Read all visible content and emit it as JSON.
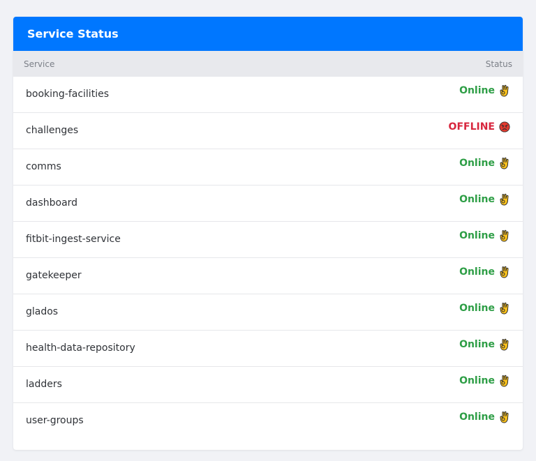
{
  "card": {
    "title": "Service Status",
    "columns": {
      "service": "Service",
      "status": "Status"
    }
  },
  "services": [
    {
      "name": "booking-facilities",
      "status": "Online",
      "state": "online",
      "icon": "ok-hand-icon"
    },
    {
      "name": "challenges",
      "status": "OFFLINE",
      "state": "offline",
      "icon": "angry-face-icon"
    },
    {
      "name": "comms",
      "status": "Online",
      "state": "online",
      "icon": "ok-hand-icon"
    },
    {
      "name": "dashboard",
      "status": "Online",
      "state": "online",
      "icon": "ok-hand-icon"
    },
    {
      "name": "fitbit-ingest-service",
      "status": "Online",
      "state": "online",
      "icon": "ok-hand-icon"
    },
    {
      "name": "gatekeeper",
      "status": "Online",
      "state": "online",
      "icon": "ok-hand-icon"
    },
    {
      "name": "glados",
      "status": "Online",
      "state": "online",
      "icon": "ok-hand-icon"
    },
    {
      "name": "health-data-repository",
      "status": "Online",
      "state": "online",
      "icon": "ok-hand-icon"
    },
    {
      "name": "ladders",
      "status": "Online",
      "state": "online",
      "icon": "ok-hand-icon"
    },
    {
      "name": "user-groups",
      "status": "Online",
      "state": "online",
      "icon": "ok-hand-icon"
    }
  ],
  "colors": {
    "header": "#0077ff",
    "online": "#2e9e46",
    "offline": "#d7263d"
  }
}
